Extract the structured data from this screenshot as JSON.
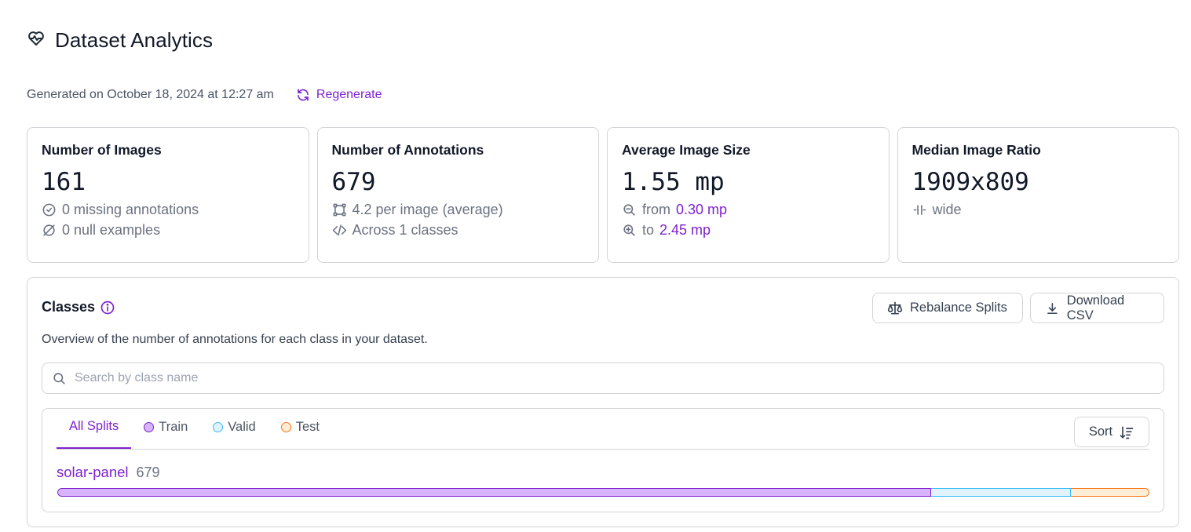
{
  "header": {
    "title": "Dataset Analytics",
    "icon": "heart-pulse-icon"
  },
  "generated": {
    "text": "Generated on October 18, 2024 at 12:27 am",
    "regenerate_label": "Regenerate"
  },
  "colors": {
    "accent": "#7e22ce",
    "train": "#d8b4fe",
    "valid": "#e0f2fe",
    "test": "#ffedd5"
  },
  "stats": [
    {
      "title": "Number of Images",
      "value": "161",
      "lines": [
        {
          "icon": "check-circle-icon",
          "text": "0 missing annotations"
        },
        {
          "icon": "null-icon",
          "text": "0 null examples"
        }
      ]
    },
    {
      "title": "Number of Annotations",
      "value": "679",
      "lines": [
        {
          "icon": "bounding-box-icon",
          "text": "4.2 per image (average)"
        },
        {
          "icon": "code-icon",
          "text": "Across 1 classes"
        }
      ]
    },
    {
      "title": "Average Image Size",
      "value": "1.55 mp",
      "lines": [
        {
          "icon": "zoom-out-icon",
          "prefix": "from",
          "highlight": "0.30 mp"
        },
        {
          "icon": "zoom-in-icon",
          "prefix": "to",
          "highlight": "2.45 mp"
        }
      ]
    },
    {
      "title": "Median Image Ratio",
      "value": "1909x809",
      "lines": [
        {
          "icon": "compress-horizontal-icon",
          "text": "wide"
        }
      ]
    }
  ],
  "classes": {
    "title": "Classes",
    "description": "Overview of the number of annotations for each class in your dataset.",
    "rebalance_label": "Rebalance Splits",
    "download_label": "Download CSV",
    "search_placeholder": "Search by class name",
    "tabs": {
      "all": "All Splits",
      "train": "Train",
      "valid": "Valid",
      "test": "Test"
    },
    "sort_label": "Sort",
    "rows": [
      {
        "name": "solar-panel",
        "count": "679",
        "splits": {
          "train": 0.8,
          "valid": 0.128,
          "test": 0.072
        }
      }
    ]
  }
}
